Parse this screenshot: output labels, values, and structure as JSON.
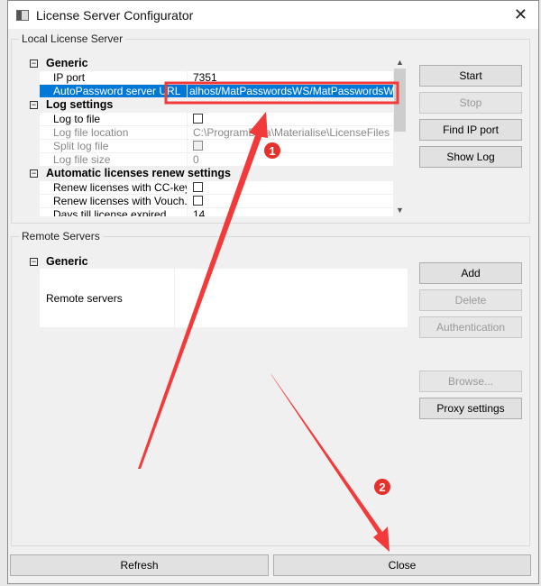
{
  "window": {
    "title": "License Server Configurator"
  },
  "local": {
    "label": "Local License Server",
    "categories": {
      "generic": "Generic",
      "log": "Log settings",
      "renew": "Automatic licenses renew settings"
    },
    "rows": {
      "ip_port": {
        "k": "IP port",
        "v": "7351"
      },
      "autopassword": {
        "k": "AutoPassword server URL",
        "v": "alhost/MatPasswordsWS/MatPasswordsWS.asmx"
      },
      "log_to_file": {
        "k": "Log to file"
      },
      "log_location": {
        "k": "Log file location",
        "v": "C:\\ProgramData\\Materialise\\LicenseFiles"
      },
      "split_log": {
        "k": "Split log file"
      },
      "log_size": {
        "k": "Log file size",
        "v": "0"
      },
      "renew_cc": {
        "k": "Renew licenses with CC-key"
      },
      "renew_voucher": {
        "k": "Renew licenses with Vouch..."
      },
      "days_till": {
        "k": "Days till license expired",
        "v": "14"
      }
    },
    "buttons": {
      "start": "Start",
      "stop": "Stop",
      "find_ip": "Find IP port",
      "show_log": "Show Log"
    }
  },
  "remote": {
    "label": "Remote Servers",
    "category": "Generic",
    "row_label": "Remote servers",
    "buttons": {
      "add": "Add",
      "delete": "Delete",
      "auth": "Authentication",
      "browse": "Browse...",
      "proxy": "Proxy settings"
    }
  },
  "footer": {
    "refresh": "Refresh",
    "close": "Close"
  },
  "annotations": {
    "step1": "1",
    "step2": "2",
    "color": "#f23a3a"
  }
}
